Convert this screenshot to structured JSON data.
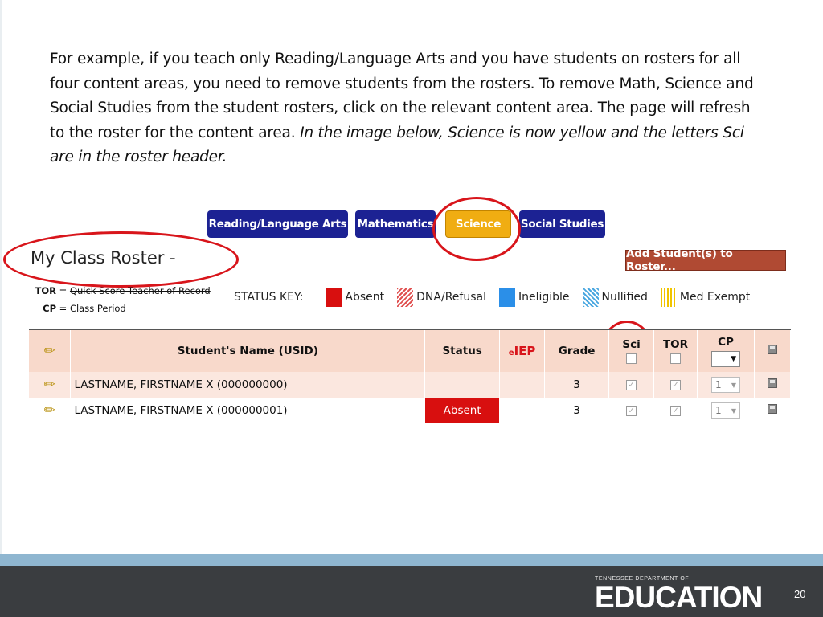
{
  "intro": {
    "text_plain": "For example, if you teach only Reading/Language Arts and you have students on rosters for all four content areas, you need to remove students from the rosters.  To remove Math, Science and Social Studies from the student rosters, click on the relevant content area. The page will refresh to the roster for the content area.  ",
    "text_italic": "In the image below, Science is now yellow and the letters Sci are in the roster header."
  },
  "tabs": [
    {
      "label": "Reading/Language Arts",
      "active": false
    },
    {
      "label": "Mathematics",
      "active": false
    },
    {
      "label": "Science",
      "active": true
    },
    {
      "label": "Social Studies",
      "active": false
    }
  ],
  "roster": {
    "title": "My Class Roster -",
    "add_button": "Add Student(s) to Roster..."
  },
  "legend": {
    "tor_abbr": "TOR",
    "tor_def": "Quick Score Teacher of Record",
    "cp_abbr": "CP",
    "cp_def": "Class Period",
    "eq": "="
  },
  "status_key": {
    "label": "STATUS KEY:",
    "items": [
      {
        "label": "Absent",
        "color": "#d80f0f"
      },
      {
        "label": "DNA/Refusal",
        "color": "#e05050"
      },
      {
        "label": "Ineligible",
        "color": "#2b8fe8"
      },
      {
        "label": "Nullified",
        "color": "#4aa7e0"
      },
      {
        "label": "Med Exempt",
        "color": "#f0c400"
      }
    ]
  },
  "table": {
    "headers": {
      "name": "Student's Name (USID)",
      "status": "Status",
      "eiep_prefix": "e",
      "eiep": "IEP",
      "grade": "Grade",
      "sci": "Sci",
      "tor": "TOR",
      "cp": "CP"
    },
    "rows": [
      {
        "name": "LASTNAME, FIRSTNAME X (000000000)",
        "status": "",
        "grade": "3",
        "sci_checked": true,
        "tor_checked": true,
        "cp": "1"
      },
      {
        "name": "LASTNAME, FIRSTNAME X (000000001)",
        "status": "Absent",
        "grade": "3",
        "sci_checked": true,
        "tor_checked": true,
        "cp": "1"
      }
    ]
  },
  "footer": {
    "org_small": "TENNESSEE DEPARTMENT OF",
    "org_big": "EDUCATION",
    "page_number": "20"
  },
  "icons": [
    "pencil-icon",
    "save-icon",
    "dropdown-arrow-icon"
  ]
}
